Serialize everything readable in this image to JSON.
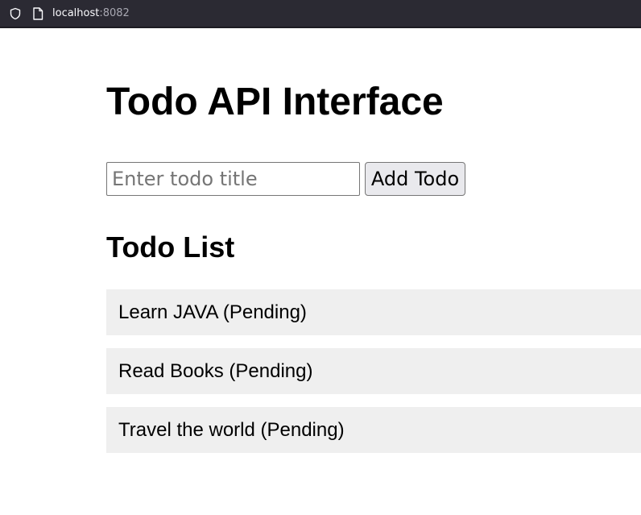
{
  "browser": {
    "url_host": "localhost",
    "url_port": ":8082",
    "icons": [
      "shield-icon",
      "page-icon"
    ]
  },
  "main": {
    "title": "Todo API Interface",
    "input_placeholder": "Enter todo title",
    "input_value": "",
    "add_button_label": "Add Todo",
    "list_title": "Todo List",
    "todos": [
      {
        "text": "Learn JAVA (Pending)"
      },
      {
        "text": "Read Books (Pending)"
      },
      {
        "text": "Travel the world (Pending)"
      }
    ]
  },
  "colors": {
    "browser_bar": "#2b2a33",
    "todo_item_bg": "#efefef",
    "button_bg": "#e9e9ed"
  }
}
